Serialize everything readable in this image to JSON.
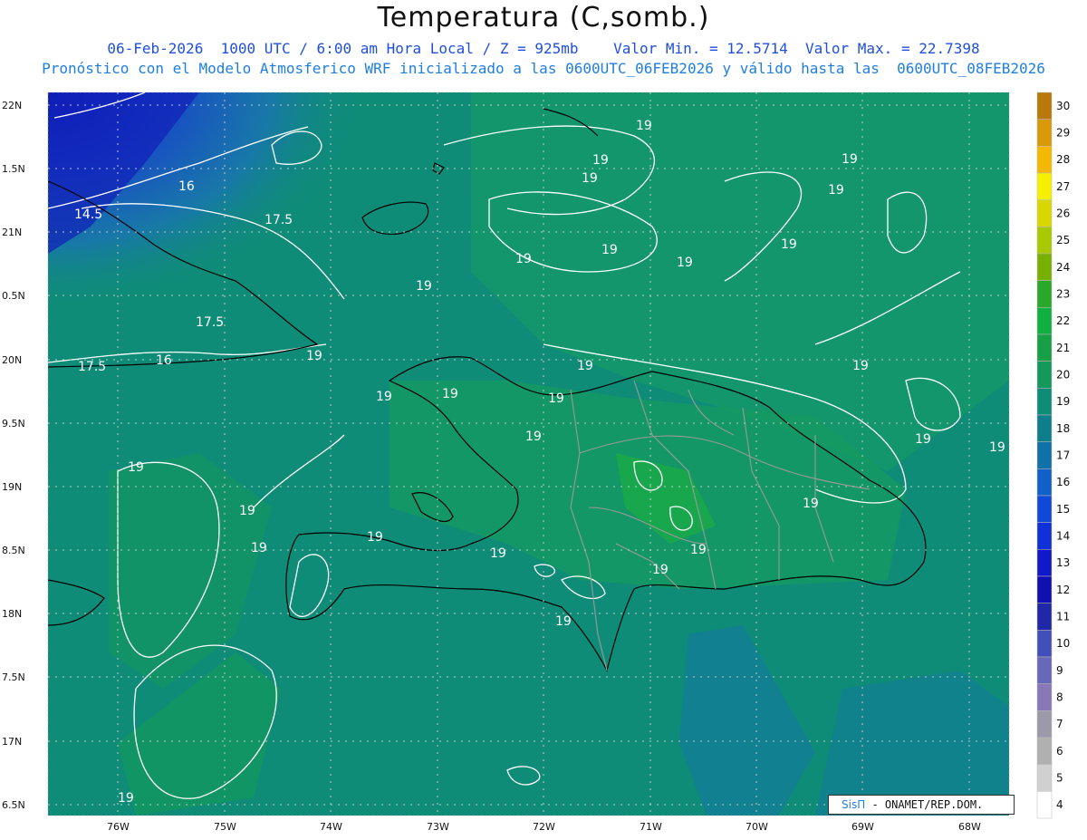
{
  "header": {
    "title": "Temperatura (C,somb.)",
    "line1": "06-Feb-2026  1000 UTC / 6:00 am Hora Local / Z = 925mb    Valor Min. = 12.5714  Valor Max. = 22.7398",
    "line2": "Pronóstico con el Modelo Atmosferico WRF inicializado a las 0600UTC_06FEB2026 y válido hasta las  0600UTC_08FEB2026"
  },
  "map": {
    "lat_ticks": [
      "22N",
      "1.5N",
      "21N",
      "0.5N",
      "20N",
      "9.5N",
      "19N",
      "8.5N",
      "18N",
      "7.5N",
      "17N",
      "6.5N"
    ],
    "lon_ticks": [
      "76W",
      "75W",
      "74W",
      "73W",
      "72W",
      "71W",
      "70W",
      "69W",
      "68W"
    ],
    "contour_labels": [
      "19",
      "19",
      "19",
      "19",
      "19",
      "19",
      "19",
      "19",
      "19",
      "19",
      "19",
      "19",
      "19",
      "19",
      "19",
      "19",
      "19",
      "19",
      "19",
      "19",
      "19",
      "19",
      "19",
      "19",
      "19",
      "19",
      "19",
      "19",
      "19",
      "14.5",
      "16",
      "17.5",
      "17.5",
      "17.5",
      "16"
    ],
    "base_color": "#0f8c78",
    "land_color": "#14a05a",
    "cold_color": "#1a2fd0"
  },
  "colorbar": {
    "labels": [
      "30",
      "29",
      "28",
      "27",
      "26",
      "25",
      "24",
      "23",
      "22",
      "21",
      "20",
      "19",
      "18",
      "17",
      "16",
      "15",
      "14",
      "13",
      "12",
      "11",
      "10",
      "9",
      "8",
      "7",
      "6",
      "5",
      "4"
    ],
    "colors": [
      "#b8780a",
      "#d89a0a",
      "#f5b800",
      "#f5f000",
      "#d8d800",
      "#a8c800",
      "#78b000",
      "#2aa82a",
      "#10b040",
      "#18a048",
      "#14985c",
      "#0f8c78",
      "#0e7f8a",
      "#1070a8",
      "#1060c8",
      "#1048d8",
      "#1030d8",
      "#1018c8",
      "#1010b0",
      "#2028a8",
      "#4050b8",
      "#6868b8",
      "#8878b8",
      "#9a9aa8",
      "#b0b0b0",
      "#d0d0d0",
      "#ffffff"
    ]
  },
  "credit": {
    "brand": "SisΠ",
    "org": " - ONAMET/REP.DOM."
  }
}
